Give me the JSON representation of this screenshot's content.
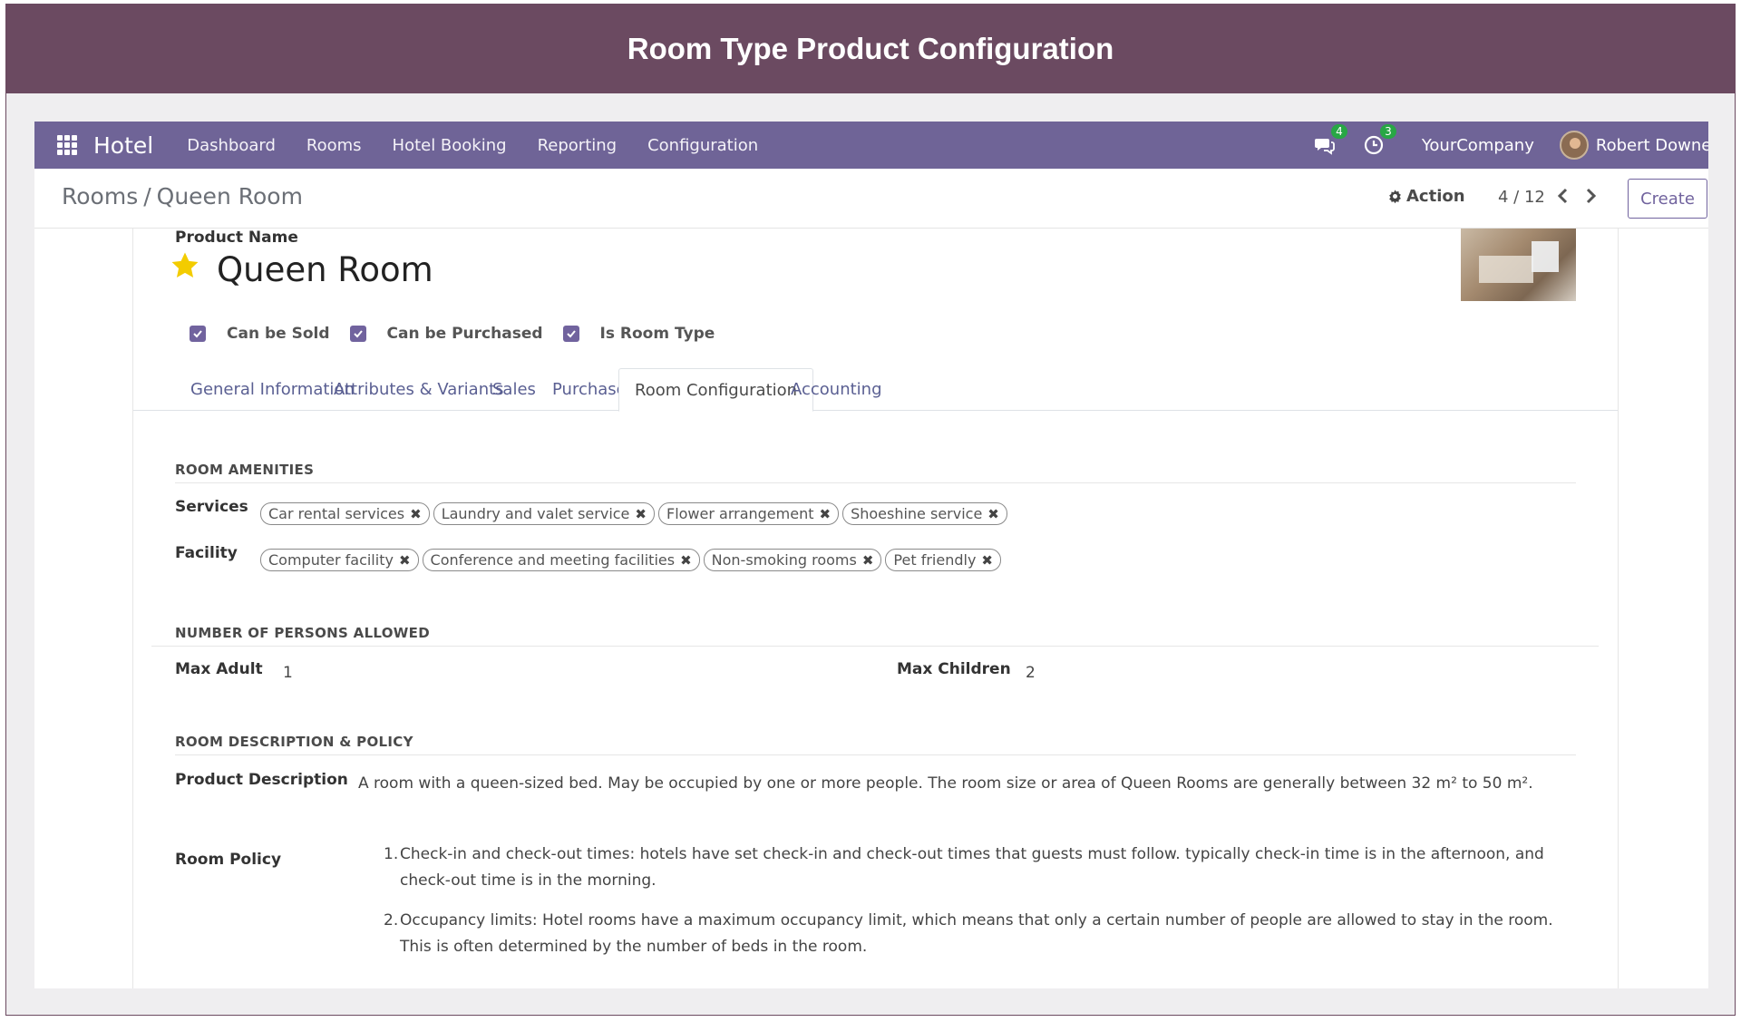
{
  "banner": {
    "title": "Room Type Product Configuration"
  },
  "navbar": {
    "app_name": "Hotel",
    "menu": [
      "Dashboard",
      "Rooms",
      "Hotel Booking",
      "Reporting",
      "Configuration"
    ],
    "messages_count": "4",
    "activities_count": "3",
    "company": "YourCompany",
    "user": "Robert Downey"
  },
  "control": {
    "breadcrumb_parent": "Rooms",
    "breadcrumb_sep": "/",
    "breadcrumb_current": "Queen Room",
    "action_label": "Action",
    "pager": "4 / 12",
    "create_label": "Create"
  },
  "product": {
    "name_label": "Product Name",
    "name": "Queen Room",
    "checkboxes": [
      {
        "label": "Can be Sold",
        "checked": true
      },
      {
        "label": "Can be Purchased",
        "checked": true
      },
      {
        "label": "Is Room Type",
        "checked": true
      }
    ]
  },
  "tabs": [
    {
      "label": "General Information",
      "active": false
    },
    {
      "label": "Attributes & Variants",
      "active": false
    },
    {
      "label": "Sales",
      "active": false
    },
    {
      "label": "Purchase",
      "active": false
    },
    {
      "label": "Room Configuration",
      "active": true
    },
    {
      "label": "Accounting",
      "active": false
    }
  ],
  "amenities": {
    "title": "ROOM AMENITIES",
    "services_label": "Services",
    "services": [
      "Car rental services",
      "Laundry and valet service",
      "Flower arrangement",
      "Shoeshine service"
    ],
    "facility_label": "Facility",
    "facilities": [
      "Computer facility",
      "Conference and meeting facilities",
      "Non-smoking rooms",
      "Pet friendly"
    ]
  },
  "persons": {
    "title": "NUMBER OF PERSONS ALLOWED",
    "max_adult_label": "Max Adult",
    "max_adult": "1",
    "max_children_label": "Max Children",
    "max_children": "2"
  },
  "policy_section": {
    "title": "ROOM DESCRIPTION & POLICY",
    "description_label": "Product Description",
    "description": "A room with a queen-sized bed. May be occupied by one or more people. The room size or area of Queen Rooms are generally between 32 m² to 50 m².",
    "policy_label": "Room Policy",
    "policies": [
      "Check-in and check-out times: hotels have set check-in and check-out times that guests must follow. typically check-in time is in the afternoon, and check-out time is in the morning.",
      "Occupancy limits: Hotel rooms have a maximum occupancy limit, which means that only a certain number of people are allowed to stay in the room. This is often determined by the number of beds in the room."
    ]
  },
  "colors": {
    "banner": "#6b4a61",
    "navbar": "#6f6497",
    "accent": "#71639e",
    "star": "#f3cc00",
    "badge": "#28a745"
  }
}
